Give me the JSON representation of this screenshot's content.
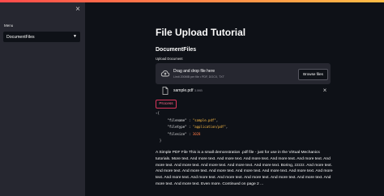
{
  "sidebar": {
    "menu_label": "Menu",
    "selected_option": "DocumentFiles"
  },
  "main": {
    "title": "File Upload Tutorial",
    "subtitle": "DocumentFiles",
    "upload_label": "Upload Document",
    "dropzone": {
      "title": "Drag and drop file here",
      "limit": "Limit 200MB per file • PDF, DOCX, TXT",
      "browse_label": "Browse files"
    },
    "file": {
      "name": "sample.pdf",
      "size": "3.0KB"
    },
    "process_label": "Process",
    "json": {
      "open": "{",
      "close": "}",
      "lines": [
        {
          "key": "\"filename\"",
          "value": "\"sample.pdf\"",
          "type": "str",
          "comma": ","
        },
        {
          "key": "\"filetype\"",
          "value": "\"application/pdf\"",
          "type": "str",
          "comma": ","
        },
        {
          "key": "\"filesize\"",
          "value": "3028",
          "type": "num",
          "comma": ""
        }
      ]
    },
    "paragraph": "A Simple PDF File This is a small demonstration .pdf file - just for use in the Virtual Mechanics tutorials. More text. And more text. And more text. And more text. And more text. And more text. And more text. And more text. And more text. And more text. And more text. Boring, zzzzz. And more text. And more text. And more text. And more text. And more text. And more text. And more text. And more text. And more text. And more text. And more text. And more text. And more text. And more text. And more text. And more text. Even more. Continued on page 2 ..."
  },
  "colors": {
    "background": "#0e1117",
    "sidebar": "#262730",
    "accent": "#ff4b4b",
    "json_string": "#ffbd45"
  }
}
